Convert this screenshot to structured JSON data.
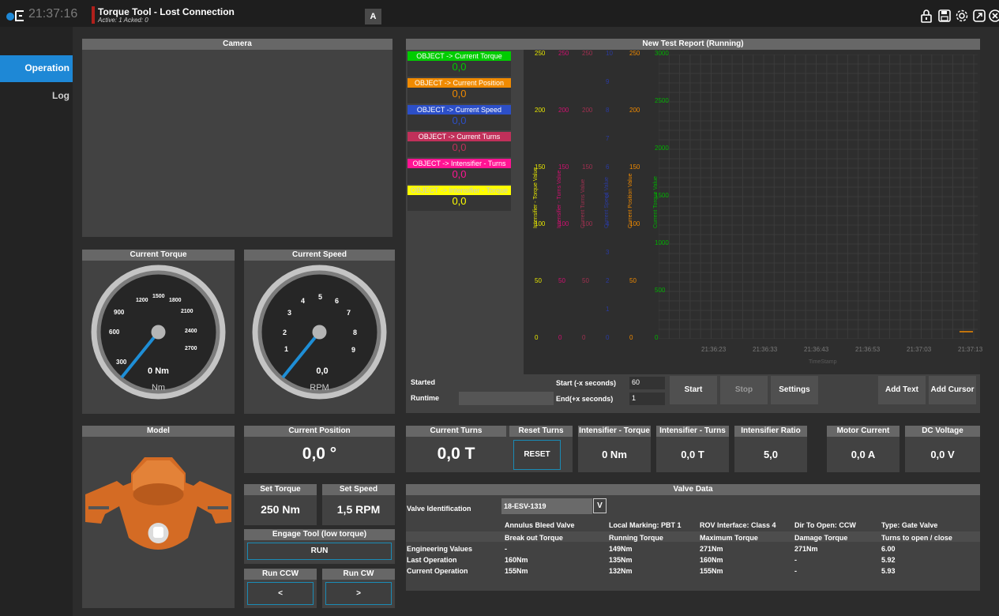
{
  "header": {
    "clock": "21:37:16",
    "alarm_title": "Torque Tool - Lost Connection",
    "alarm_sub": "Active: 1 Acked: 0",
    "a_button": "A",
    "icons": [
      "lock-icon",
      "save-icon",
      "settings-icon",
      "fullscreen-icon",
      "close-icon"
    ]
  },
  "sidebar": {
    "items": [
      "Operation",
      "Log"
    ]
  },
  "camera": {
    "title": "Camera"
  },
  "gauges": {
    "torque": {
      "title": "Current Torque",
      "value": "0 Nm",
      "unit": "Nm",
      "ticks": [
        "300",
        "600",
        "900",
        "1200",
        "1500",
        "1800",
        "2100",
        "2400",
        "2700"
      ]
    },
    "speed": {
      "title": "Current Speed",
      "value": "0,0",
      "unit": "RPM",
      "ticks": [
        "1",
        "2",
        "3",
        "4",
        "5",
        "6",
        "7",
        "8",
        "9"
      ]
    }
  },
  "model": {
    "title": "Model"
  },
  "position": {
    "title": "Current Position",
    "value": "0,0 °"
  },
  "set": {
    "torque_label": "Set Torque",
    "torque_value": "250 Nm",
    "speed_label": "Set Speed",
    "speed_value": "1,5 RPM"
  },
  "engage": {
    "title": "Engage Tool (low torque)",
    "button": "RUN"
  },
  "run": {
    "ccw_label": "Run CCW",
    "ccw_button": "<",
    "cw_label": "Run CW",
    "cw_button": ">"
  },
  "report": {
    "title": "New Test Report (Running)",
    "legend": [
      {
        "label": "OBJECT -> Current Torque",
        "value": "0,0",
        "color": "#00cc00",
        "text": "#ffffff",
        "valcolor": "#00cc00"
      },
      {
        "label": "OBJECT -> Current Position",
        "value": "0,0",
        "color": "#f08a00",
        "text": "#ffffff",
        "valcolor": "#f08a00"
      },
      {
        "label": "OBJECT -> Current Speed",
        "value": "0,0",
        "color": "#2c4fc8",
        "text": "#ffffff",
        "valcolor": "#2c4fc8"
      },
      {
        "label": "OBJECT -> Current Turns",
        "value": "0,0",
        "color": "#c0305a",
        "text": "#ffffff",
        "valcolor": "#c0305a"
      },
      {
        "label": "OBJECT -> Intensifier - Turns",
        "value": "0,0",
        "color": "#ff1493",
        "text": "#ffffff",
        "valcolor": "#ff1493"
      },
      {
        "label": "OBJECT -> Intensifier - Torque",
        "value": "0,0",
        "color": "#ffff00",
        "text": "#c8c8c8",
        "valcolor": "#ffff00"
      }
    ],
    "axes": [
      {
        "label": "Intensifier - Torque Value",
        "color": "#e6e600",
        "ticks": [
          "250",
          "200",
          "150",
          "100",
          "50",
          "0"
        ]
      },
      {
        "label": "Intensifier - Turns Value",
        "color": "#d01070",
        "ticks": [
          "250",
          "200",
          "150",
          "100",
          "50",
          "0"
        ]
      },
      {
        "label": "Current Turns Value",
        "color": "#a03050",
        "ticks": [
          "250",
          "200",
          "150",
          "100",
          "50",
          "0"
        ]
      },
      {
        "label": "Current Speed Value",
        "color": "#2a3aa0",
        "ticks": [
          "10",
          "9",
          "8",
          "7",
          "6",
          "5",
          "4",
          "3",
          "2",
          "1",
          "0"
        ]
      },
      {
        "label": "Current Position Value",
        "color": "#f08a00",
        "ticks": [
          "250",
          "200",
          "150",
          "100",
          "50",
          "0"
        ]
      },
      {
        "label": "Current Torque Value",
        "color": "#00b000",
        "ticks": [
          "3000",
          "2500",
          "2000",
          "1500",
          "1000",
          "500",
          "0"
        ]
      }
    ],
    "x_ticks": [
      "21:36:23",
      "21:36:33",
      "21:36:43",
      "21:36:53",
      "21:37:03",
      "21:37:13"
    ],
    "x_label": "TimeStamp",
    "started_label": "Started",
    "runtime_label": "Runtime",
    "start_label": "Start (-x seconds)",
    "start_value": "60",
    "end_label": "End(+x seconds)",
    "end_value": "1",
    "buttons": {
      "start": "Start",
      "stop": "Stop",
      "settings": "Settings",
      "add_text": "Add Text",
      "add_cursor": "Add Cursor"
    }
  },
  "turns": {
    "title": "Current Turns",
    "value": "0,0 T",
    "reset_title": "Reset Turns",
    "reset_button": "RESET"
  },
  "intens_torque": {
    "title": "Intensifier - Torque",
    "value": "0 Nm"
  },
  "intens_turns": {
    "title": "Intensifier - Turns",
    "value": "0,0 T"
  },
  "intens_ratio": {
    "title": "Intensifier Ratio",
    "value": "5,0"
  },
  "motor_current": {
    "title": "Motor Current",
    "value": "0,0 A"
  },
  "dc_voltage": {
    "title": "DC Voltage",
    "value": "0,0 V"
  },
  "valve": {
    "title": "Valve Data",
    "id_label": "Valve Identification",
    "id_value": "18-ESV-1319",
    "dropdown": "V",
    "info": [
      "Annulus Bleed Valve",
      "Local Marking: PBT 1",
      "ROV Interface: Class 4",
      "Dir To Open: CCW",
      "Type: Gate Valve"
    ],
    "columns": [
      "Break out Torque",
      "Running Torque",
      "Maximum Torque",
      "Damage Torque",
      "Turns to open / close"
    ],
    "rows": [
      {
        "label": "Engineering Values",
        "cells": [
          "-",
          "149Nm",
          "271Nm",
          "271Nm",
          "6.00"
        ]
      },
      {
        "label": "Last Operation",
        "cells": [
          "160Nm",
          "135Nm",
          "160Nm",
          "-",
          "5.92"
        ]
      },
      {
        "label": "Current Operation",
        "cells": [
          "155Nm",
          "132Nm",
          "155Nm",
          "-",
          "5.93"
        ]
      }
    ]
  }
}
